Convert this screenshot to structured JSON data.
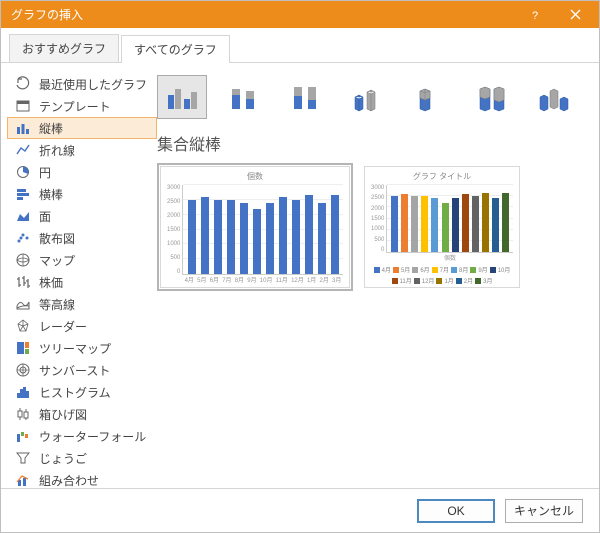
{
  "dialog_title": "グラフの挿入",
  "tabs": {
    "recommended": "おすすめグラフ",
    "all": "すべてのグラフ"
  },
  "sidebar": {
    "items": [
      {
        "label": "最近使用したグラフ"
      },
      {
        "label": "テンプレート"
      },
      {
        "label": "縦棒"
      },
      {
        "label": "折れ線"
      },
      {
        "label": "円"
      },
      {
        "label": "横棒"
      },
      {
        "label": "面"
      },
      {
        "label": "散布図"
      },
      {
        "label": "マップ"
      },
      {
        "label": "株価"
      },
      {
        "label": "等高線"
      },
      {
        "label": "レーダー"
      },
      {
        "label": "ツリーマップ"
      },
      {
        "label": "サンバースト"
      },
      {
        "label": "ヒストグラム"
      },
      {
        "label": "箱ひげ図"
      },
      {
        "label": "ウォーターフォール"
      },
      {
        "label": "じょうご"
      },
      {
        "label": "組み合わせ"
      }
    ]
  },
  "section_title": "集合縦棒",
  "footer": {
    "ok": "OK",
    "cancel": "キャンセル"
  },
  "preview1_title": "個数",
  "preview2_title": "グラフ タイトル",
  "preview2_xlabel": "個数",
  "chart_data": [
    {
      "type": "bar",
      "title": "個数",
      "xlabel": "",
      "ylabel": "",
      "ylim": [
        0,
        3000
      ],
      "yticks": [
        0,
        500,
        1000,
        1500,
        2000,
        2500,
        3000
      ],
      "categories": [
        "4月",
        "5月",
        "6月",
        "7月",
        "8月",
        "9月",
        "10月",
        "11月",
        "12月",
        "1月",
        "2月",
        "3月"
      ],
      "values": [
        2500,
        2600,
        2500,
        2500,
        2400,
        2200,
        2400,
        2600,
        2500,
        2650,
        2400,
        2650
      ]
    },
    {
      "type": "bar",
      "title": "グラフ タイトル",
      "xlabel": "個数",
      "ylabel": "",
      "ylim": [
        0,
        3000
      ],
      "yticks": [
        0,
        500,
        1000,
        1500,
        2000,
        2500,
        3000
      ],
      "categories": [
        "4月",
        "5月",
        "6月",
        "7月",
        "8月",
        "9月",
        "10月",
        "11月",
        "12月",
        "1月",
        "2月",
        "3月"
      ],
      "series": [
        {
          "name": "4月",
          "values": [
            2500
          ],
          "color": "#4472c4"
        },
        {
          "name": "5月",
          "values": [
            2600
          ],
          "color": "#ed7d31"
        },
        {
          "name": "6月",
          "values": [
            2500
          ],
          "color": "#a5a5a5"
        },
        {
          "name": "7月",
          "values": [
            2500
          ],
          "color": "#ffc000"
        },
        {
          "name": "8月",
          "values": [
            2400
          ],
          "color": "#5b9bd5"
        },
        {
          "name": "9月",
          "values": [
            2200
          ],
          "color": "#70ad47"
        },
        {
          "name": "10月",
          "values": [
            2400
          ],
          "color": "#264478"
        },
        {
          "name": "11月",
          "values": [
            2600
          ],
          "color": "#9e480e"
        },
        {
          "name": "12月",
          "values": [
            2500
          ],
          "color": "#636363"
        },
        {
          "name": "1月",
          "values": [
            2650
          ],
          "color": "#997300"
        },
        {
          "name": "2月",
          "values": [
            2400
          ],
          "color": "#255e91"
        },
        {
          "name": "3月",
          "values": [
            2650
          ],
          "color": "#43682b"
        }
      ]
    }
  ]
}
